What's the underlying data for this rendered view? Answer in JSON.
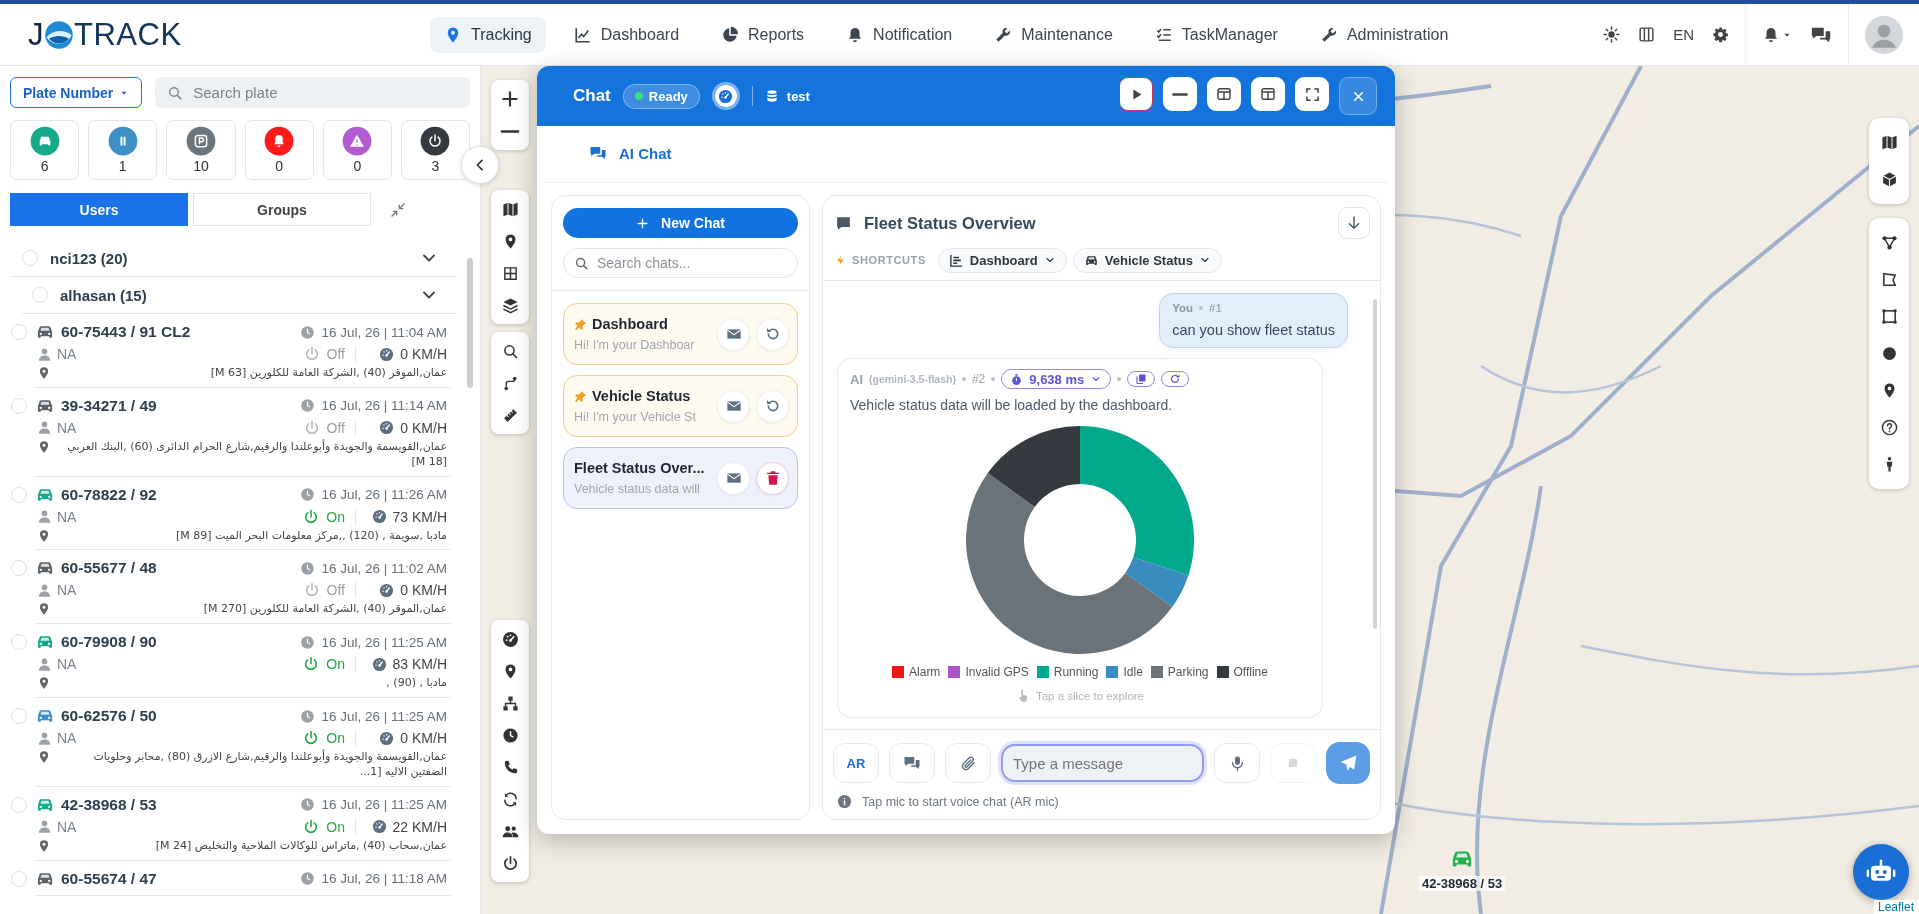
{
  "header": {
    "logo_start": "J",
    "logo_end": "TRACK",
    "nav": [
      {
        "label": "Tracking",
        "selected": true
      },
      {
        "label": "Dashboard",
        "selected": false
      },
      {
        "label": "Reports",
        "selected": false
      },
      {
        "label": "Notification",
        "selected": false
      },
      {
        "label": "Maintenance",
        "selected": false
      },
      {
        "label": "TaskManager",
        "selected": false
      },
      {
        "label": "Administration",
        "selected": false
      }
    ],
    "language": "EN"
  },
  "sidebar": {
    "filter_button": "Plate Number",
    "search": {
      "placeholder": "Search plate"
    },
    "status_tiles": [
      {
        "count": "6",
        "color": "#15a88a"
      },
      {
        "count": "1",
        "color": "#3d8fc6"
      },
      {
        "count": "10",
        "color": "#6c757d"
      },
      {
        "count": "0",
        "color": "#ff1a1a"
      },
      {
        "count": "0",
        "color": "#b25ccf"
      },
      {
        "count": "3",
        "color": "#343a40"
      }
    ],
    "tabs": [
      {
        "label": "Users",
        "selected": true
      },
      {
        "label": "Groups",
        "selected": false
      }
    ],
    "tree": [
      {
        "label": "nci123 (20)",
        "checked": false,
        "expanded": true,
        "children": [
          {
            "label": "alhasan (15)",
            "checked": false,
            "expanded": true,
            "vehicles": [
              {
                "plate": "60-75443 / 91 CL2",
                "time": "16 Jul, 26 | 11:04 AM",
                "driver": "NA",
                "ignition": "Off",
                "on": false,
                "speed": "0 KM/H",
                "address": "عمان,الموقر (40) ,الشركة العامة للكلورين [M 63]",
                "color": "#5b6168",
                "checked": false
              },
              {
                "plate": "39-34271 / 49",
                "time": "16 Jul, 26 | 11:14 AM",
                "driver": "NA",
                "ignition": "Off",
                "on": false,
                "speed": "0 KM/H",
                "address": "عمان,القويسمة والجويدة وأبوعلندا والرقيم,شارع الحرام الدائرى (60) ,البنك العربي [M 18]",
                "color": "#5b6168",
                "checked": false
              },
              {
                "plate": "60-78822 / 92",
                "time": "16 Jul, 26 | 11:26 AM",
                "driver": "NA",
                "ignition": "On",
                "on": true,
                "speed": "73 KM/H",
                "address": "مادبا ,سويمة , (120) ,,مركز معلومات البحر الميت [M 89]",
                "color": "#15a88a",
                "checked": false
              },
              {
                "plate": "60-55677 / 48",
                "time": "16 Jul, 26 | 11:02 AM",
                "driver": "NA",
                "ignition": "Off",
                "on": false,
                "speed": "0 KM/H",
                "address": "عمان,الموقر (40) ,الشركة العامة للكلورين [M 270]",
                "color": "#5b6168",
                "checked": false
              },
              {
                "plate": "60-79908 / 90",
                "time": "16 Jul, 26 | 11:25 AM",
                "driver": "NA",
                "ignition": "On",
                "on": true,
                "speed": "83 KM/H",
                "address": "مادبا , (90) ,",
                "color": "#15a88a",
                "checked": false
              },
              {
                "plate": "60-62576 / 50",
                "time": "16 Jul, 26 | 11:25 AM",
                "driver": "NA",
                "ignition": "On",
                "on": true,
                "speed": "0 KM/H",
                "address": "عمان,القويسمة والجويدة وأبوعلندا والرقيم,شارع الازرق (80) ,محابر وحلويات الضفتين الاليه [1...",
                "color": "#3d8fc6",
                "checked": false
              },
              {
                "plate": "42-38968 / 53",
                "time": "16 Jul, 26 | 11:25 AM",
                "driver": "NA",
                "ignition": "On",
                "on": true,
                "speed": "22 KM/H",
                "address": "عمان,سحاب (40) ,ماتراس للوكالات الملاحية والتخليص [M 24]",
                "color": "#15a88a",
                "checked": false
              },
              {
                "plate": "60-55674 / 47",
                "time": "16 Jul, 26 | 11:18 AM",
                "color": "#5b6168",
                "checked": false
              }
            ]
          }
        ]
      }
    ]
  },
  "map": {
    "vehicle_marker": {
      "label": "42-38968 / 53"
    },
    "attribution": "Leaflet"
  },
  "chat": {
    "title": "Chat",
    "status": "Ready",
    "workspace": "test",
    "tabs": [
      {
        "label": "AI Chat",
        "selected": true
      }
    ],
    "new_chat": "New Chat",
    "search": {
      "placeholder": "Search chats..."
    },
    "conversations": [
      {
        "title": "Dashboard",
        "preview": "Hi! I'm your Dashboar",
        "pinned": true,
        "selected": false,
        "deletable": false
      },
      {
        "title": "Vehicle Status",
        "preview": "Hi! I'm your Vehicle St",
        "pinned": true,
        "selected": false,
        "deletable": false
      },
      {
        "title": "Fleet Status Over...",
        "preview": "Vehicle status data will",
        "pinned": false,
        "selected": true,
        "deletable": true
      }
    ],
    "conversation_title": "Fleet Status Overview",
    "shortcuts_label": "SHORTCUTS",
    "shortcuts": [
      {
        "label": "Dashboard"
      },
      {
        "label": "Vehicle Status"
      }
    ],
    "messages": [
      {
        "kind": "user",
        "author": "You",
        "number": "#1",
        "text": "can you show fleet status"
      },
      {
        "kind": "ai",
        "author": "AI",
        "model": "(gemini-3.5-flash)",
        "number": "#2",
        "duration": "9,638 ms",
        "text": "Vehicle status data will be loaded by the dashboard.",
        "legend": [
          {
            "label": "Alarm",
            "color": "#f01515"
          },
          {
            "label": "Invalid GPS",
            "color": "#a855c8"
          },
          {
            "label": "Running",
            "color": "#00a98b"
          },
          {
            "label": "Idle",
            "color": "#3a8bbf"
          },
          {
            "label": "Parking",
            "color": "#6b737a"
          },
          {
            "label": "Offline",
            "color": "#343a40"
          }
        ],
        "hint": "Tap a slice to explore"
      }
    ],
    "composer": {
      "language": "AR",
      "placeholder": "Type a message",
      "stop_disabled": true,
      "hint": "Tap mic to start voice chat (AR mic)"
    }
  }
}
